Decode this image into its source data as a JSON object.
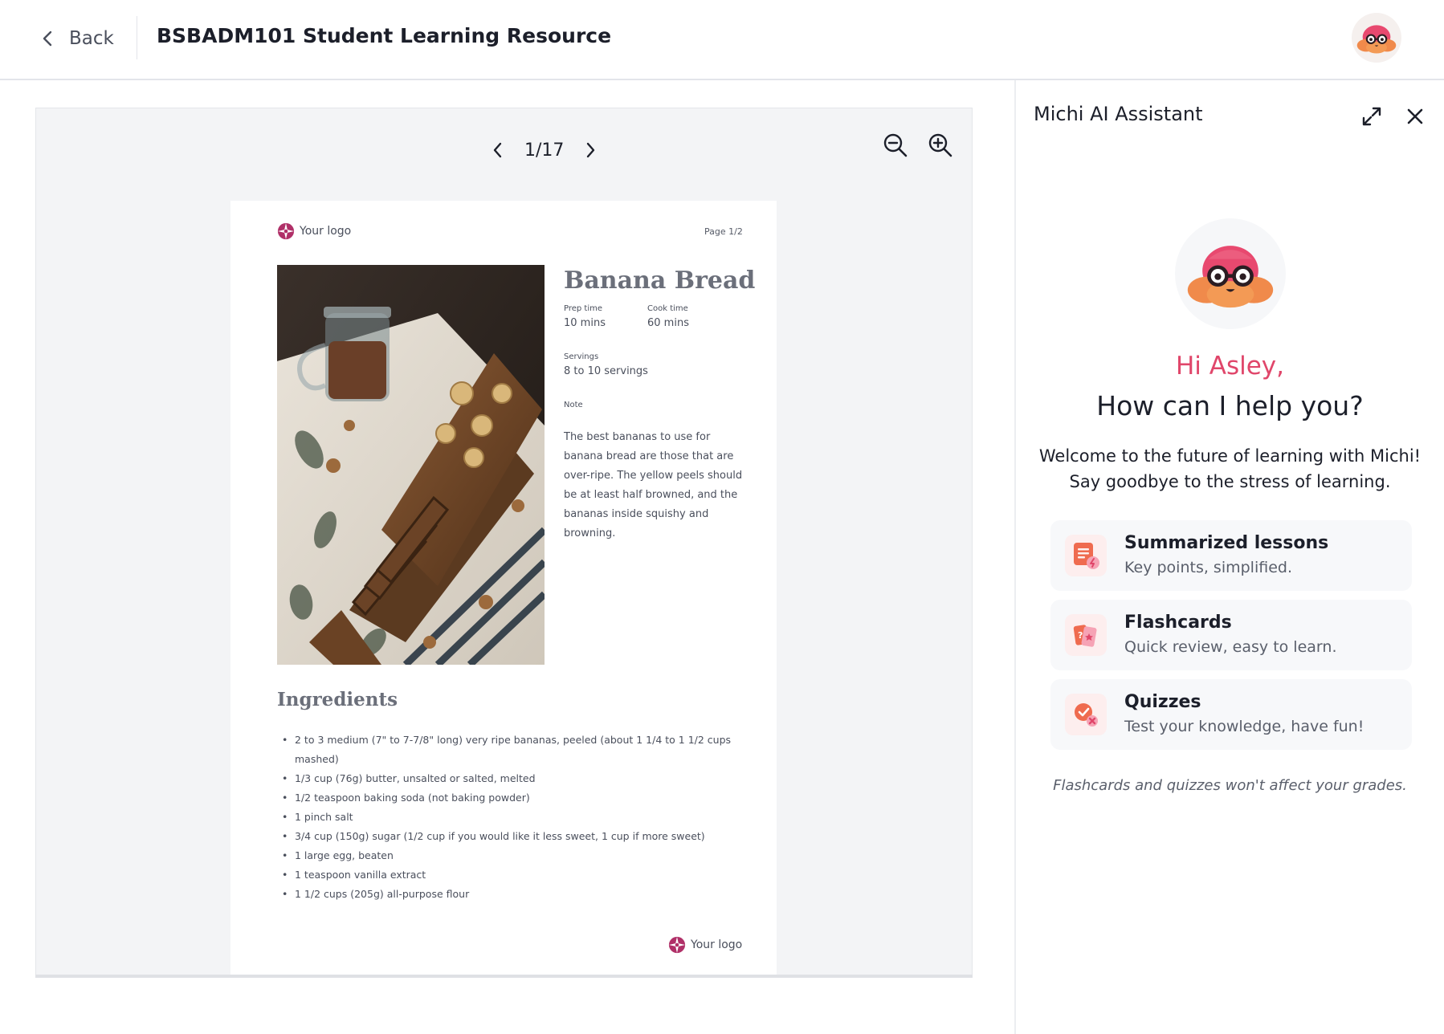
{
  "header": {
    "back_label": "Back",
    "title": "BSBADM101 Student Learning Resource"
  },
  "viewer": {
    "page_indicator": "1/17",
    "current_page": 1,
    "total_pages": 17
  },
  "document": {
    "logo_text": "Your logo",
    "page_label": "Page 1/2",
    "title": "Banana Bread",
    "prep_time_label": "Prep time",
    "prep_time_value": "10 mins",
    "cook_time_label": "Cook time",
    "cook_time_value": "60 mins",
    "servings_label": "Servings",
    "servings_value": "8 to 10 servings",
    "note_label": "Note",
    "note_text": "The best bananas to use for banana bread are those that are over-ripe. The yellow peels should be at least half browned, and the bananas inside squishy and browning.",
    "ingredients_title": "Ingredients",
    "ingredients": [
      "2 to 3 medium (7\" to 7-7/8\" long) very ripe bananas, peeled (about 1 1/4 to 1 1/2 cups mashed)",
      "1/3 cup (76g) butter, unsalted or salted, melted",
      "1/2 teaspoon baking soda (not baking powder)",
      "1 pinch salt",
      "3/4 cup (150g) sugar (1/2 cup if you would like it less sweet, 1 cup if more sweet)",
      "1 large egg, beaten",
      "1 teaspoon vanilla extract",
      "1 1/2 cups (205g) all-purpose flour"
    ]
  },
  "assistant": {
    "title": "Michi AI Assistant",
    "greeting": "Hi Asley,",
    "help_question": "How can I help you?",
    "welcome_line1": "Welcome to the future of learning with Michi!",
    "welcome_line2": "Say goodbye to the stress of learning.",
    "features": [
      {
        "icon": "summary-icon",
        "title": "Summarized lessons",
        "description": "Key points, simplified."
      },
      {
        "icon": "flashcards-icon",
        "title": "Flashcards",
        "description": "Quick review, easy to learn."
      },
      {
        "icon": "quiz-icon",
        "title": "Quizzes",
        "description": "Test your knowledge, have fun!"
      }
    ],
    "footnote": "Flashcards and quizzes won't affect your grades."
  },
  "colors": {
    "accent": "#e0466a",
    "mascot_pink": "#e8496f",
    "mascot_orange": "#f08a4b",
    "viewer_bg": "#f3f4f6"
  }
}
